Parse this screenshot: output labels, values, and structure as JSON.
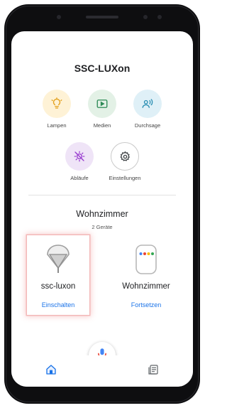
{
  "app": {
    "title": "SSC-LUXon"
  },
  "tiles": [
    {
      "label": "Lampen",
      "icon": "lightbulb-icon",
      "bg": "#fef2d6",
      "fg": "#e3a01b"
    },
    {
      "label": "Medien",
      "icon": "media-play-icon",
      "bg": "#e3f1e6",
      "fg": "#2e8b57"
    },
    {
      "label": "Durchsage",
      "icon": "broadcast-person-icon",
      "bg": "#dff0f7",
      "fg": "#2a8fb3"
    },
    {
      "label": "Abläufe",
      "icon": "routine-sun-icon",
      "bg": "#efe4f7",
      "fg": "#9a3fd0"
    },
    {
      "label": "Einstellungen",
      "icon": "gear-icon",
      "bg": "#ffffff",
      "fg": "#3c4043"
    }
  ],
  "room": {
    "name": "Wohnzimmer",
    "device_count": "2 Geräte"
  },
  "devices": [
    {
      "name": "ssc-luxon",
      "action": "Einschalten",
      "icon": "lamp-icon",
      "selected": true
    },
    {
      "name": "Wohnzimmer",
      "action": "Fortsetzen",
      "icon": "smart-speaker-icon",
      "selected": false
    }
  ],
  "nav": {
    "home_icon": "home-icon",
    "feed_icon": "feed-icon",
    "mic_icon": "microphone-icon"
  },
  "colors": {
    "accent": "#1a73e8",
    "selection_glow": "#f3b8b8"
  }
}
